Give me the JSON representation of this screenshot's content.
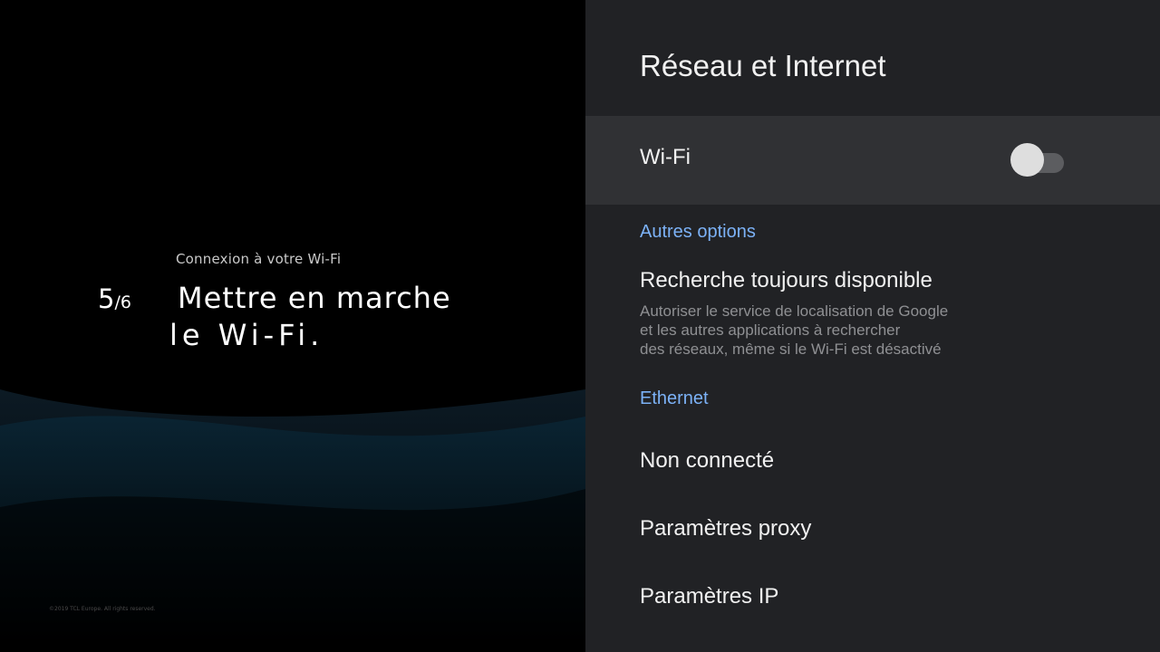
{
  "tutorial": {
    "subtitle": "Connexion à votre Wi-Fi",
    "step_current": "5",
    "step_total": "/6",
    "headline_line1": "Mettre en marche",
    "headline_line2": "le Wi-Fi.",
    "copyright": "©2019 TCL Europe. All rights reserved."
  },
  "settings": {
    "title": "Réseau et Internet",
    "wifi": {
      "label": "Wi-Fi",
      "enabled": false
    },
    "other_options_header": "Autres options",
    "scan_always": {
      "title": "Recherche toujours disponible",
      "description": [
        "Autoriser le service de localisation de Google",
        "et les autres applications à rechercher",
        "des réseaux, même si le Wi-Fi est désactivé"
      ]
    },
    "ethernet_header": "Ethernet",
    "ethernet_status": "Non connecté",
    "proxy_settings": "Paramètres proxy",
    "ip_settings": "Paramètres IP"
  },
  "colors": {
    "panel_bg": "#212225",
    "selected_row_bg": "#303134",
    "section_header": "#7cb2f7"
  }
}
